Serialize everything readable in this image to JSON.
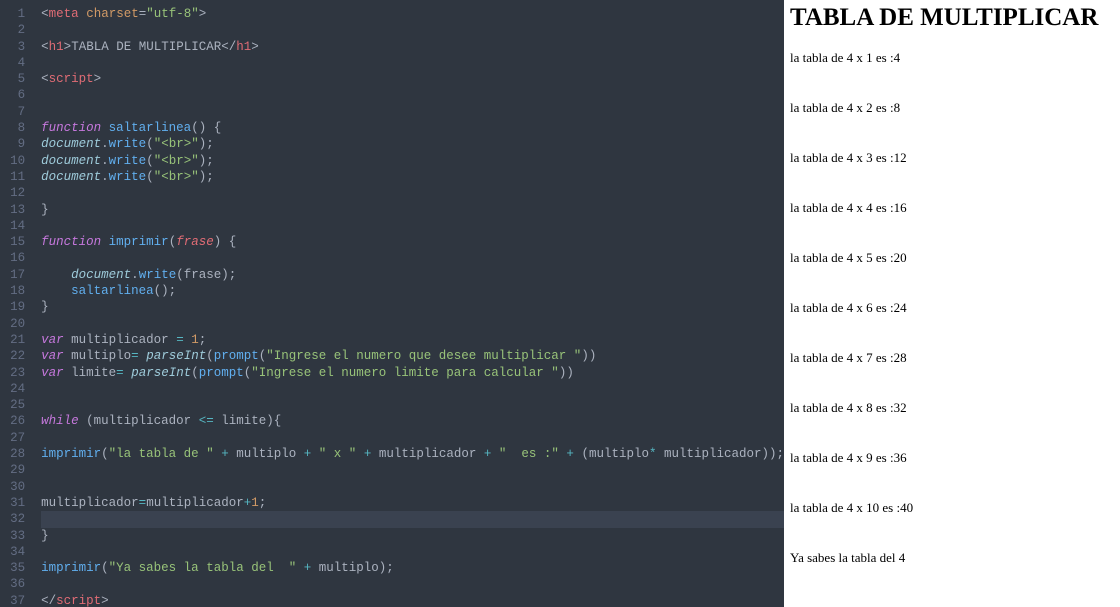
{
  "editor": {
    "lineCount": 37,
    "highlightedLine": 32,
    "lines": {
      "1": [
        {
          "t": "<",
          "c": "punc"
        },
        {
          "t": "meta",
          "c": "tag"
        },
        {
          "t": " ",
          "c": "txt"
        },
        {
          "t": "charset",
          "c": "attr"
        },
        {
          "t": "=",
          "c": "punc"
        },
        {
          "t": "\"utf-8\"",
          "c": "str"
        },
        {
          "t": ">",
          "c": "punc"
        }
      ],
      "2": [],
      "3": [
        {
          "t": "<",
          "c": "punc"
        },
        {
          "t": "h1",
          "c": "tag"
        },
        {
          "t": ">",
          "c": "punc"
        },
        {
          "t": "TABLA DE MULTIPLICAR",
          "c": "txt"
        },
        {
          "t": "</",
          "c": "punc"
        },
        {
          "t": "h1",
          "c": "tag"
        },
        {
          "t": ">",
          "c": "punc"
        }
      ],
      "4": [],
      "5": [
        {
          "t": "<",
          "c": "punc"
        },
        {
          "t": "script",
          "c": "tag"
        },
        {
          "t": ">",
          "c": "punc"
        }
      ],
      "6": [],
      "7": [],
      "8": [
        {
          "t": "function",
          "c": "kw"
        },
        {
          "t": " ",
          "c": "txt"
        },
        {
          "t": "saltarlinea",
          "c": "fn"
        },
        {
          "t": "() {",
          "c": "punc"
        }
      ],
      "9": [
        {
          "t": "document",
          "c": "obj"
        },
        {
          "t": ".",
          "c": "punc"
        },
        {
          "t": "write",
          "c": "mth"
        },
        {
          "t": "(",
          "c": "punc"
        },
        {
          "t": "\"<br>\"",
          "c": "str"
        },
        {
          "t": ");",
          "c": "punc"
        }
      ],
      "10": [
        {
          "t": "document",
          "c": "obj"
        },
        {
          "t": ".",
          "c": "punc"
        },
        {
          "t": "write",
          "c": "mth"
        },
        {
          "t": "(",
          "c": "punc"
        },
        {
          "t": "\"<br>\"",
          "c": "str"
        },
        {
          "t": ");",
          "c": "punc"
        }
      ],
      "11": [
        {
          "t": "document",
          "c": "obj"
        },
        {
          "t": ".",
          "c": "punc"
        },
        {
          "t": "write",
          "c": "mth"
        },
        {
          "t": "(",
          "c": "punc"
        },
        {
          "t": "\"<br>\"",
          "c": "str"
        },
        {
          "t": ");",
          "c": "punc"
        }
      ],
      "12": [],
      "13": [
        {
          "t": "}",
          "c": "punc"
        }
      ],
      "14": [],
      "15": [
        {
          "t": "function",
          "c": "kw"
        },
        {
          "t": " ",
          "c": "txt"
        },
        {
          "t": "imprimir",
          "c": "fn"
        },
        {
          "t": "(",
          "c": "punc"
        },
        {
          "t": "frase",
          "c": "prm"
        },
        {
          "t": ") {",
          "c": "punc"
        }
      ],
      "16": [],
      "17": [
        {
          "t": "    ",
          "c": "txt"
        },
        {
          "t": "document",
          "c": "obj"
        },
        {
          "t": ".",
          "c": "punc"
        },
        {
          "t": "write",
          "c": "mth"
        },
        {
          "t": "(frase);",
          "c": "punc"
        }
      ],
      "18": [
        {
          "t": "    ",
          "c": "txt"
        },
        {
          "t": "saltarlinea",
          "c": "mth"
        },
        {
          "t": "();",
          "c": "punc"
        }
      ],
      "19": [
        {
          "t": "}",
          "c": "punc"
        }
      ],
      "20": [],
      "21": [
        {
          "t": "var",
          "c": "kw"
        },
        {
          "t": " multiplicador ",
          "c": "txt"
        },
        {
          "t": "=",
          "c": "op"
        },
        {
          "t": " ",
          "c": "txt"
        },
        {
          "t": "1",
          "c": "num"
        },
        {
          "t": ";",
          "c": "punc"
        }
      ],
      "22": [
        {
          "t": "var",
          "c": "kw"
        },
        {
          "t": " multiplo",
          "c": "txt"
        },
        {
          "t": "= ",
          "c": "op"
        },
        {
          "t": "parseInt",
          "c": "obj"
        },
        {
          "t": "(",
          "c": "punc"
        },
        {
          "t": "prompt",
          "c": "mth"
        },
        {
          "t": "(",
          "c": "punc"
        },
        {
          "t": "\"Ingrese el numero que desee multiplicar \"",
          "c": "str"
        },
        {
          "t": "))",
          "c": "punc"
        }
      ],
      "23": [
        {
          "t": "var",
          "c": "kw"
        },
        {
          "t": " limite",
          "c": "txt"
        },
        {
          "t": "= ",
          "c": "op"
        },
        {
          "t": "parseInt",
          "c": "obj"
        },
        {
          "t": "(",
          "c": "punc"
        },
        {
          "t": "prompt",
          "c": "mth"
        },
        {
          "t": "(",
          "c": "punc"
        },
        {
          "t": "\"Ingrese el numero limite para calcular \"",
          "c": "str"
        },
        {
          "t": "))",
          "c": "punc"
        }
      ],
      "24": [],
      "25": [],
      "26": [
        {
          "t": "while",
          "c": "kw"
        },
        {
          "t": " (multiplicador ",
          "c": "txt"
        },
        {
          "t": "<=",
          "c": "op"
        },
        {
          "t": " limite){",
          "c": "punc"
        }
      ],
      "27": [],
      "28": [
        {
          "t": "imprimir",
          "c": "mth"
        },
        {
          "t": "(",
          "c": "punc"
        },
        {
          "t": "\"la tabla de \"",
          "c": "str"
        },
        {
          "t": " ",
          "c": "txt"
        },
        {
          "t": "+",
          "c": "op"
        },
        {
          "t": " multiplo ",
          "c": "txt"
        },
        {
          "t": "+",
          "c": "op"
        },
        {
          "t": " ",
          "c": "txt"
        },
        {
          "t": "\" x \"",
          "c": "str"
        },
        {
          "t": " ",
          "c": "txt"
        },
        {
          "t": "+",
          "c": "op"
        },
        {
          "t": " multiplicador ",
          "c": "txt"
        },
        {
          "t": "+",
          "c": "op"
        },
        {
          "t": " ",
          "c": "txt"
        },
        {
          "t": "\"  es :\"",
          "c": "str"
        },
        {
          "t": " ",
          "c": "txt"
        },
        {
          "t": "+",
          "c": "op"
        },
        {
          "t": " (multiplo",
          "c": "txt"
        },
        {
          "t": "*",
          "c": "op"
        },
        {
          "t": " multiplicador));",
          "c": "punc"
        }
      ],
      "29": [],
      "30": [],
      "31": [
        {
          "t": "multiplicador",
          "c": "txt"
        },
        {
          "t": "=",
          "c": "op"
        },
        {
          "t": "multiplicador",
          "c": "txt"
        },
        {
          "t": "+",
          "c": "op"
        },
        {
          "t": "1",
          "c": "num"
        },
        {
          "t": ";",
          "c": "punc"
        }
      ],
      "32": [],
      "33": [
        {
          "t": "}",
          "c": "punc"
        }
      ],
      "34": [],
      "35": [
        {
          "t": "imprimir",
          "c": "mth"
        },
        {
          "t": "(",
          "c": "punc"
        },
        {
          "t": "\"Ya sabes la tabla del  \"",
          "c": "str"
        },
        {
          "t": " ",
          "c": "txt"
        },
        {
          "t": "+",
          "c": "op"
        },
        {
          "t": " multiplo);",
          "c": "punc"
        }
      ],
      "36": [],
      "37": [
        {
          "t": "</",
          "c": "punc"
        },
        {
          "t": "script",
          "c": "tag"
        },
        {
          "t": ">",
          "c": "punc"
        }
      ]
    }
  },
  "preview": {
    "title": "TABLA DE MULTIPLICAR",
    "rows": [
      "la tabla de 4 x 1 es :4",
      "la tabla de 4 x 2 es :8",
      "la tabla de 4 x 3 es :12",
      "la tabla de 4 x 4 es :16",
      "la tabla de 4 x 5 es :20",
      "la tabla de 4 x 6 es :24",
      "la tabla de 4 x 7 es :28",
      "la tabla de 4 x 8 es :32",
      "la tabla de 4 x 9 es :36",
      "la tabla de 4 x 10 es :40",
      "Ya sabes la tabla del 4"
    ]
  }
}
